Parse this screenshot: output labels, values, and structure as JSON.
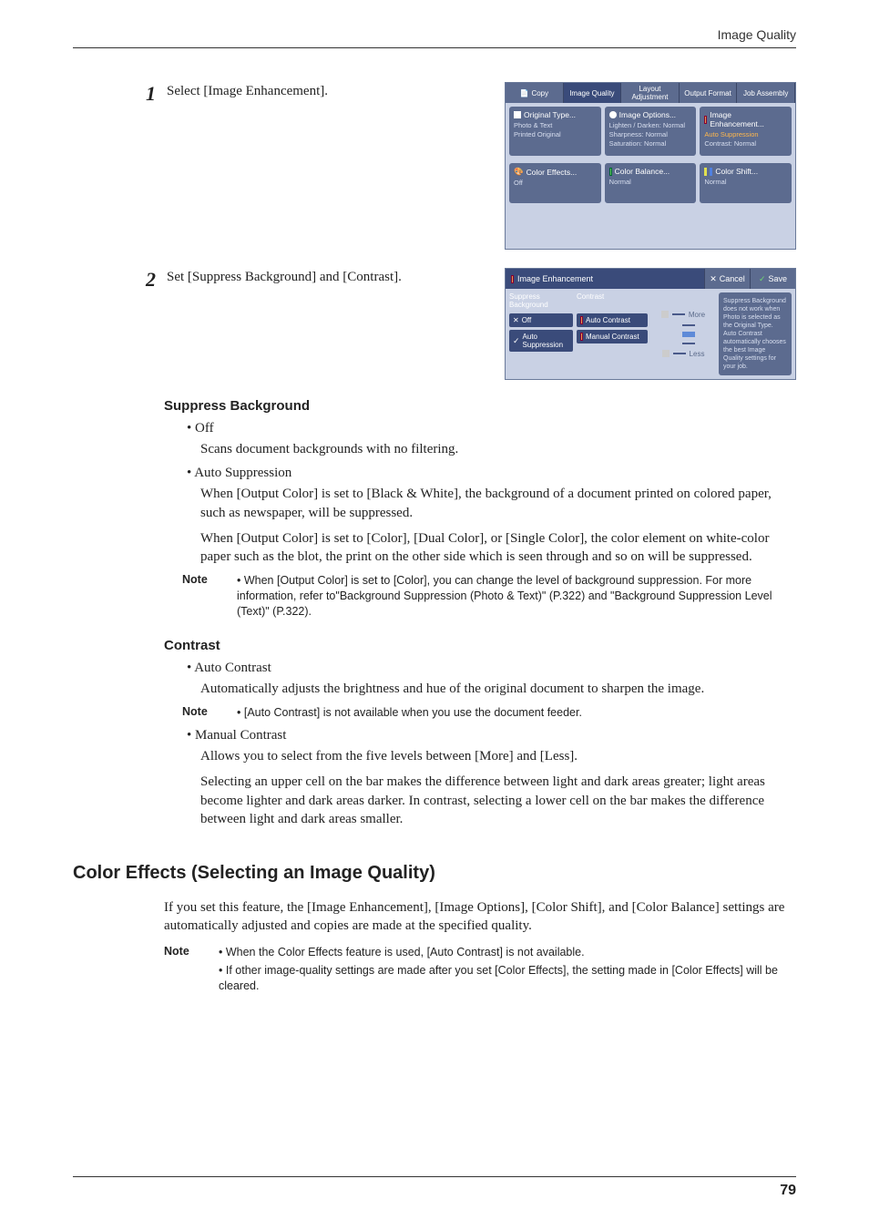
{
  "header": {
    "title": "Image Quality"
  },
  "steps": {
    "s1": {
      "num": "1",
      "text": "Select [Image Enhancement]."
    },
    "s2": {
      "num": "2",
      "text": "Set [Suppress Background] and [Contrast]."
    }
  },
  "shot1": {
    "tabs": {
      "copy": "Copy",
      "iq": "Image Quality",
      "layout": "Layout Adjustment",
      "output": "Output Format",
      "job": "Job Assembly"
    },
    "r1c1": {
      "title": "Original Type...",
      "l1": "Photo & Text",
      "l2": "Printed Original"
    },
    "r1c2": {
      "title": "Image Options...",
      "l1": "Lighten / Darken: Normal",
      "l2": "Sharpness: Normal",
      "l3": "Saturation: Normal"
    },
    "r1c3": {
      "title": "Image Enhancement...",
      "l1": "Auto Suppression",
      "l2": "Contrast: Normal"
    },
    "r2c1": {
      "title": "Color Effects...",
      "l1": "Off"
    },
    "r2c2": {
      "title": "Color Balance...",
      "l1": "Normal"
    },
    "r2c3": {
      "title": "Color Shift...",
      "l1": "Normal"
    }
  },
  "shot2": {
    "title": "Image Enhancement",
    "cancel": "Cancel",
    "save": "Save",
    "col1": {
      "head": "Suppress Background",
      "opt1": "Off",
      "opt2": "Auto Suppression"
    },
    "col2": {
      "head": "Contrast",
      "opt1": "Auto Contrast",
      "opt2": "Manual Contrast"
    },
    "slider": {
      "more": "More",
      "less": "Less"
    },
    "help": "Suppress Background does not work when Photo is selected as the Original Type.\n\nAuto Contrast automatically chooses the best Image Quality settings for your job."
  },
  "body": {
    "h_sb": "Suppress Background",
    "sb_off": "Off",
    "sb_off_p": "Scans document backgrounds with no filtering.",
    "sb_auto": "Auto Suppression",
    "sb_auto_p1": "When [Output Color] is set to [Black & White], the background of a document printed on colored paper, such as newspaper, will be suppressed.",
    "sb_auto_p2": "When [Output Color] is set to [Color], [Dual Color], or [Single Color], the color element on white-color paper such as the blot, the print on the other side which is seen through and so on will be suppressed.",
    "note1_label": "Note",
    "note1": "When [Output Color] is set to [Color], you can change the level of background suppression. For more information, refer to\"Background Suppression (Photo & Text)\" (P.322) and \"Background Suppression Level (Text)\" (P.322).",
    "h_ct": "Contrast",
    "ct_auto": "Auto Contrast",
    "ct_auto_p": "Automatically adjusts the brightness and hue of the original document to sharpen the image.",
    "note2_label": "Note",
    "note2": "[Auto Contrast] is not available when you use the document feeder.",
    "ct_manual": "Manual Contrast",
    "ct_manual_p1": "Allows you to select from the five levels between [More] and [Less].",
    "ct_manual_p2": "Selecting an upper cell on the bar makes the difference between light and dark areas greater; light areas become lighter and dark areas darker. In contrast, selecting a lower cell on the bar makes the difference between light and dark areas smaller.",
    "h2": "Color Effects (Selecting an Image Quality)",
    "sec_p": "If you set this feature, the [Image Enhancement], [Image Options], [Color Shift], and [Color Balance] settings are automatically adjusted and copies are made at the specified quality.",
    "note3_label": "Note",
    "note3a": "When the Color Effects feature is used, [Auto Contrast] is not available.",
    "note3b": "If other image-quality settings are made after you set [Color Effects], the setting made in [Color Effects] will be cleared."
  },
  "footer": {
    "page": "79"
  }
}
